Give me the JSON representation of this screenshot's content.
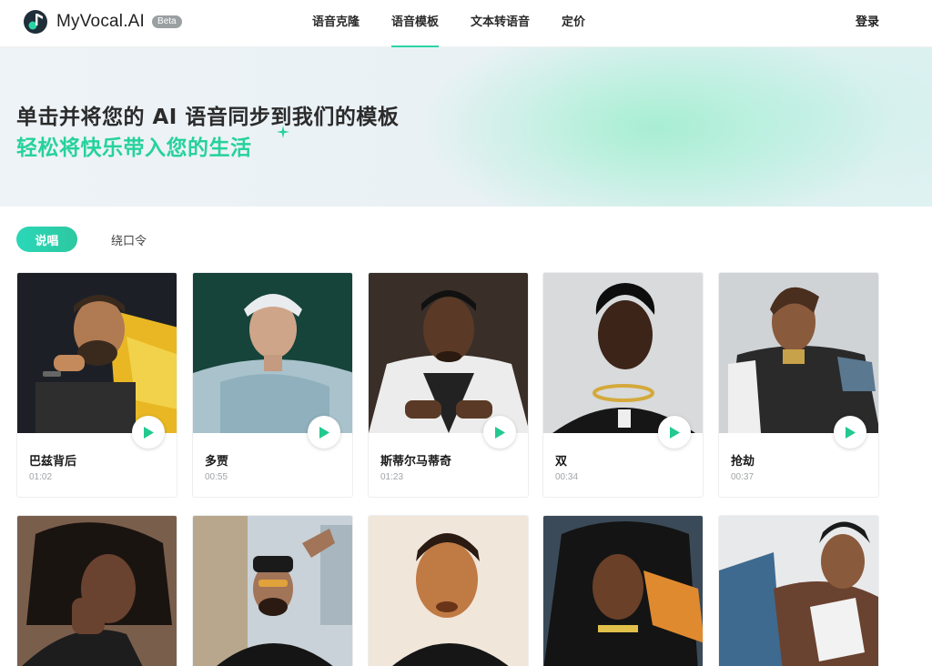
{
  "header": {
    "logo_text": "MyVocal.AI",
    "beta_label": "Beta",
    "nav": [
      {
        "label": "语音克隆",
        "active": false
      },
      {
        "label": "语音模板",
        "active": true
      },
      {
        "label": "文本转语音",
        "active": false
      },
      {
        "label": "定价",
        "active": false
      }
    ],
    "login_label": "登录"
  },
  "banner": {
    "title": "单击并将您的 AI 语音同步到我们的模板",
    "subtitle": "轻松将快乐带入您的生活"
  },
  "tabs": [
    {
      "label": "说唱",
      "active": true
    },
    {
      "label": "绕口令",
      "active": false
    }
  ],
  "cards": [
    {
      "title": "巴兹背后",
      "duration": "01:02"
    },
    {
      "title": "多贾",
      "duration": "00:55"
    },
    {
      "title": "斯蒂尔马蒂奇",
      "duration": "01:23"
    },
    {
      "title": "双",
      "duration": "00:34"
    },
    {
      "title": "抢劫",
      "duration": "00:37"
    }
  ],
  "colors": {
    "accent": "#2bd4a4",
    "accent_text": "#26d29b",
    "play_icon": "#23c98e"
  },
  "icons": {
    "logo": "music-note-icon",
    "play": "play-icon",
    "sparkle": "sparkle-icon"
  }
}
